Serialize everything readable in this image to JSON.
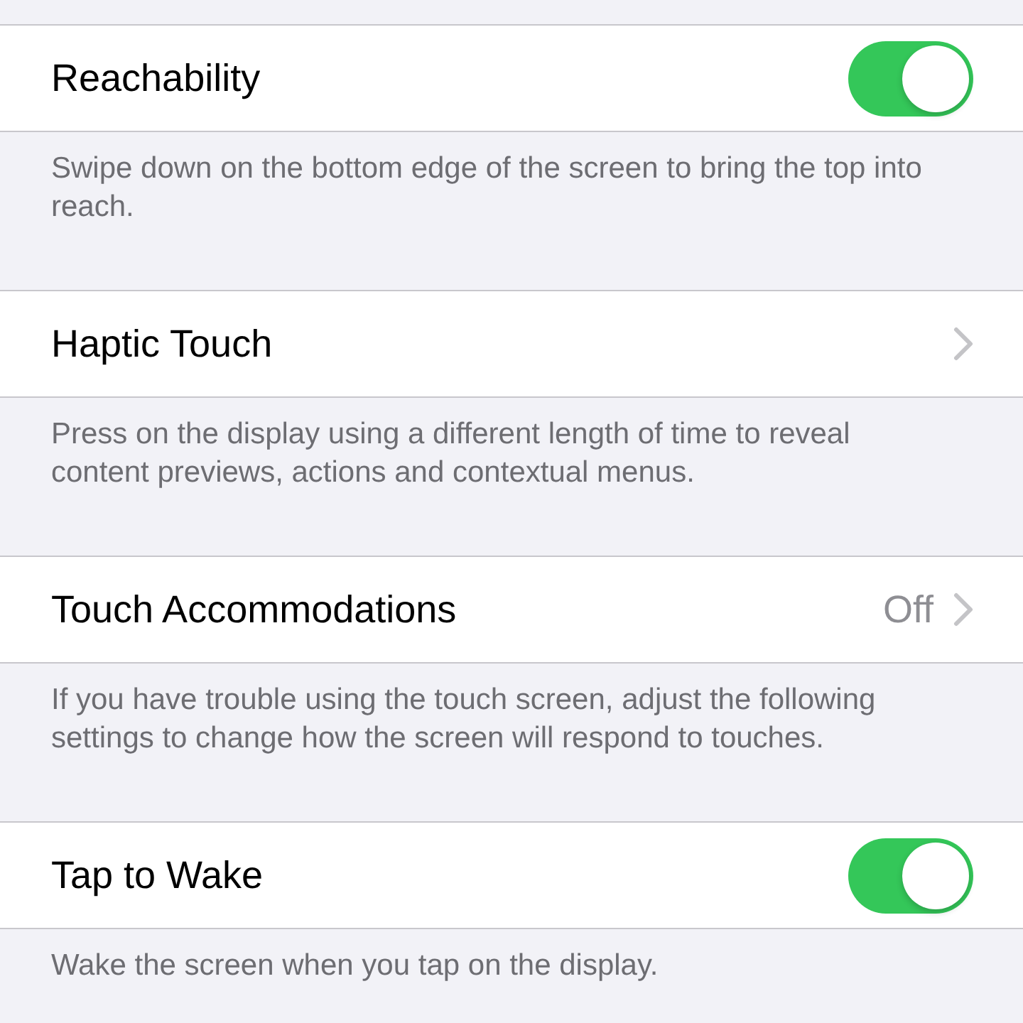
{
  "groups": [
    {
      "row": {
        "kind": "toggle",
        "label": "Reachability",
        "on": true
      },
      "footer": "Swipe down on the bottom edge of the screen to bring the top into reach."
    },
    {
      "row": {
        "kind": "disclosure",
        "label": "Haptic Touch"
      },
      "footer": "Press on the display using a different length of time to reveal content previews, actions and contextual menus."
    },
    {
      "row": {
        "kind": "disclosure",
        "label": "Touch Accommodations",
        "value": "Off"
      },
      "footer": "If you have trouble using the touch screen, adjust the following settings to change how the screen will respond to touches."
    },
    {
      "row": {
        "kind": "toggle",
        "label": "Tap to Wake",
        "on": true
      },
      "footer": "Wake the screen when you tap on the display."
    }
  ]
}
